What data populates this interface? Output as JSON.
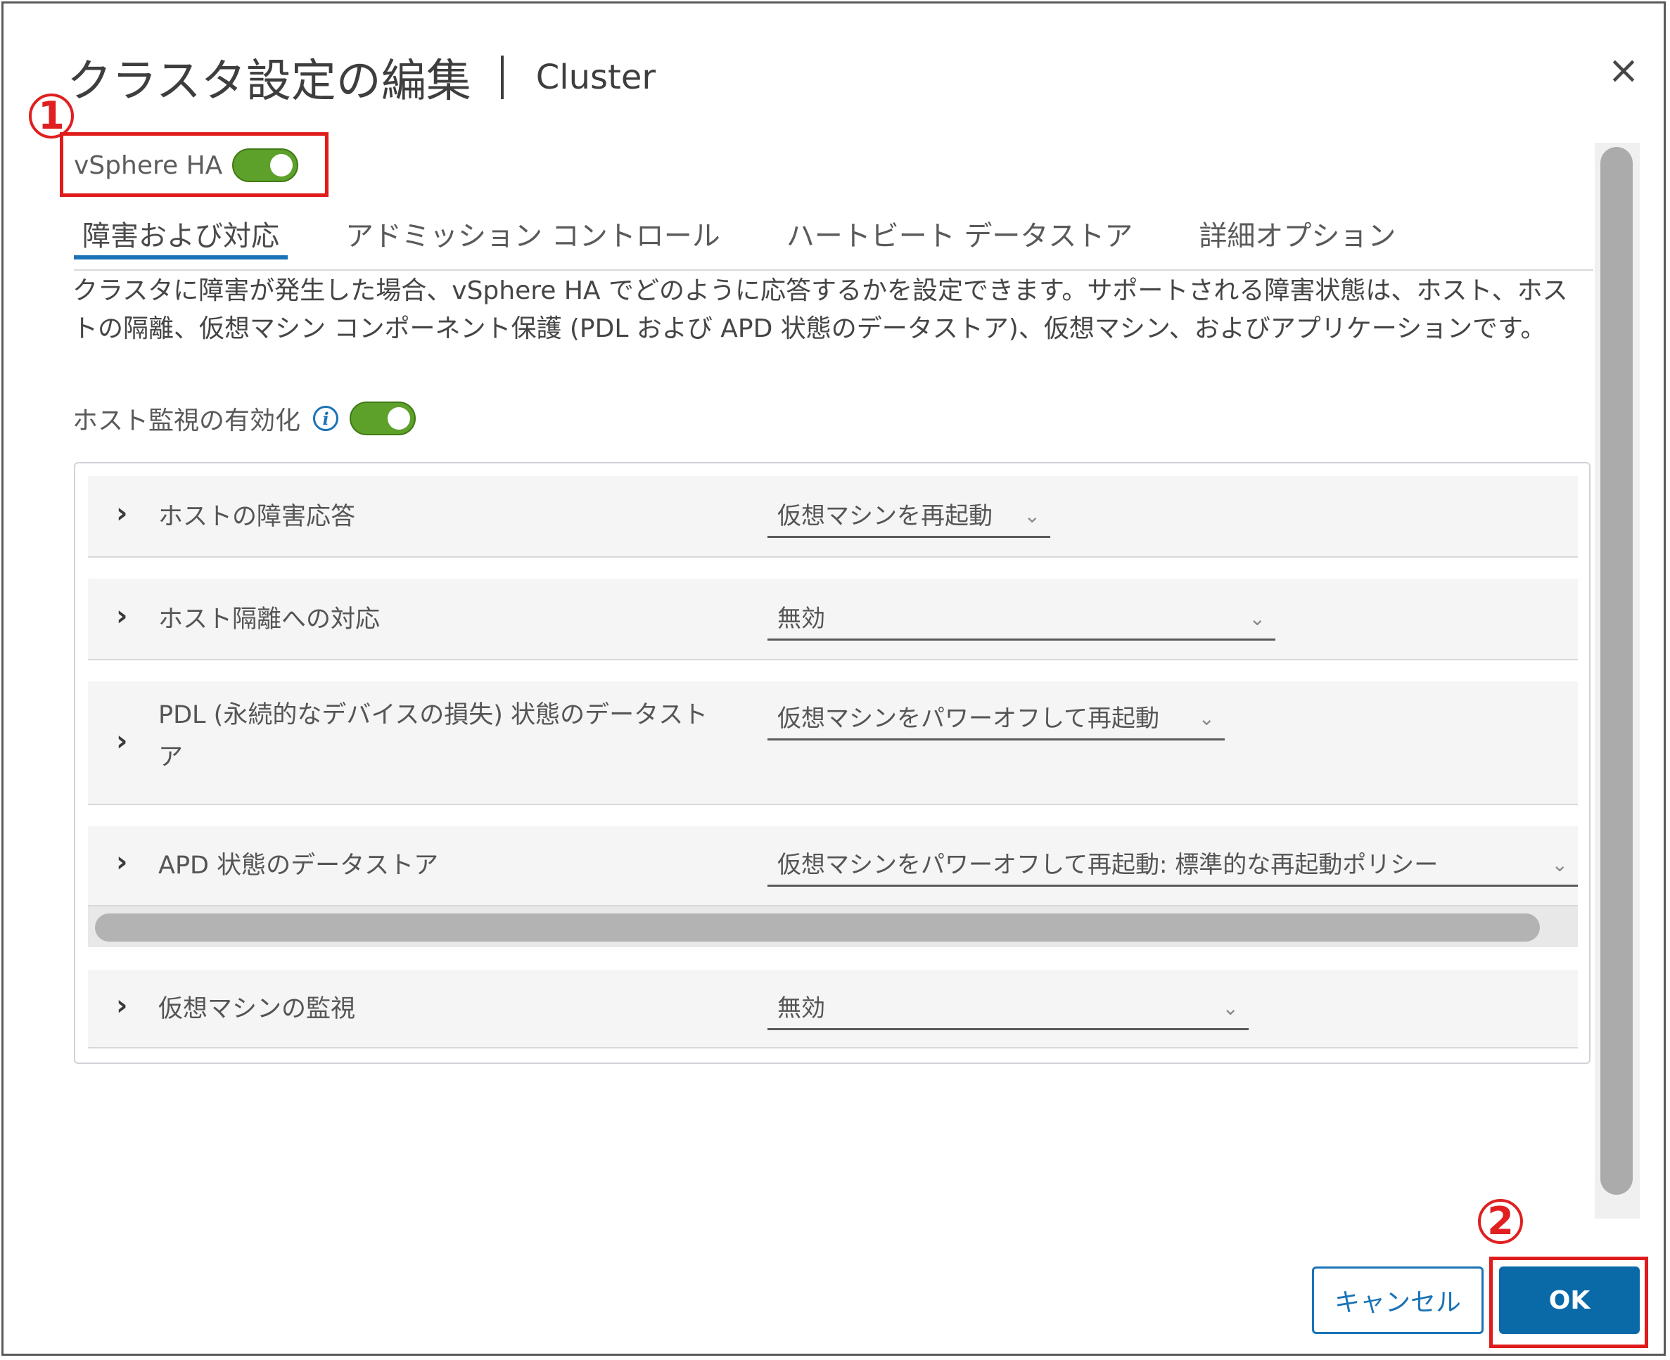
{
  "dialog": {
    "title": "クラスタ設定の編集",
    "subtitle": "Cluster",
    "close_glyph": "×"
  },
  "annotations": {
    "marker1": "1",
    "marker2": "2",
    "color": "#e01b1b"
  },
  "vsphere_ha": {
    "label": "vSphere HA",
    "enabled": true
  },
  "tabs": [
    {
      "label": "障害および対応",
      "active": true
    },
    {
      "label": "アドミッション コントロール",
      "active": false
    },
    {
      "label": "ハートビート データストア",
      "active": false
    },
    {
      "label": "詳細オプション",
      "active": false
    }
  ],
  "description": "クラスタに障害が発生した場合、vSphere HA でどのように応答するかを設定できます。サポートされる障害状態は、ホスト、ホストの隔離、仮想マシン コンポーネント保護 (PDL および APD 状態のデータストア)、仮想マシン、およびアプリケーションです。",
  "host_monitoring": {
    "label": "ホスト監視の有効化",
    "info_glyph": "i",
    "enabled": true
  },
  "rows": [
    {
      "label": "ホストの障害応答",
      "value": "仮想マシンを再起動"
    },
    {
      "label": "ホスト隔離への対応",
      "value": "無効"
    },
    {
      "label": "PDL (永続的なデバイスの損失) 状態のデータストア",
      "value": "仮想マシンをパワーオフして再起動"
    },
    {
      "label": "APD 状態のデータストア",
      "value": "仮想マシンをパワーオフして再起動: 標準的な再起動ポリシー"
    },
    {
      "label": "仮想マシンの監視",
      "value": "無効"
    }
  ],
  "glyphs": {
    "chevron": "›",
    "caret": "⌄"
  },
  "footer": {
    "cancel_label": "キャンセル",
    "ok_label": "OK"
  },
  "colors": {
    "toggle_on": "#5ea12a",
    "primary": "#0a6aa8",
    "tab_underline": "#1a73b6"
  }
}
